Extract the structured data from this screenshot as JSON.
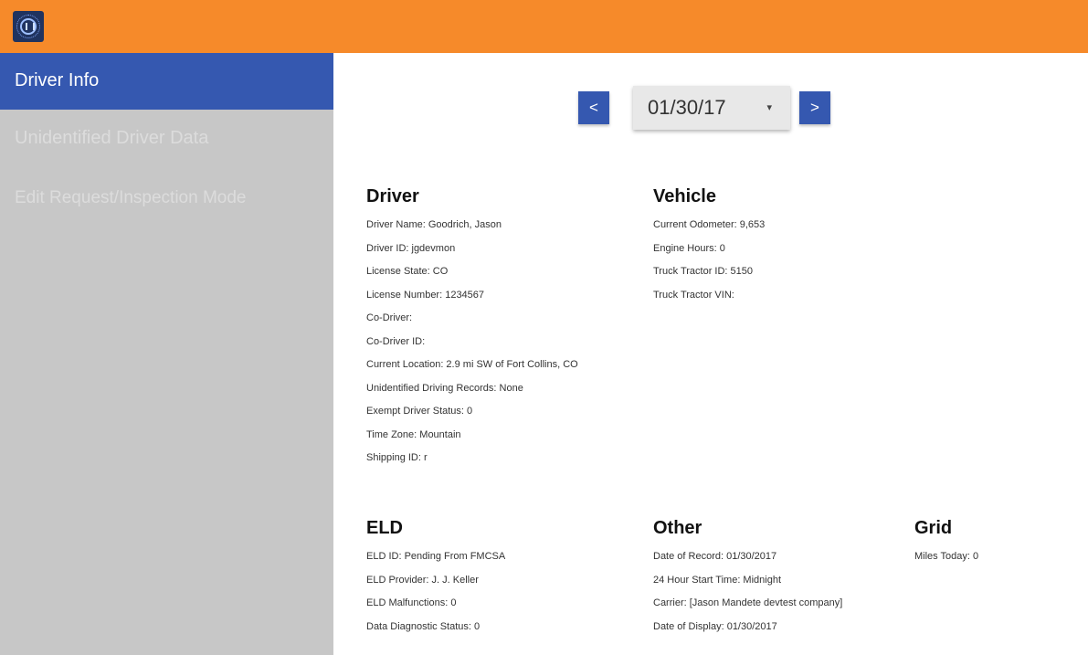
{
  "header": {
    "logo_icon": "truck-logo-icon",
    "app_title": "",
    "background_color": "#f68a2a"
  },
  "sidebar": {
    "items": [
      {
        "label": "Driver Info",
        "active": true
      },
      {
        "label": "Unidentified Driver Data",
        "active": false
      },
      {
        "label": "Edit Request/Inspection Mode",
        "active": false
      }
    ],
    "active_color": "#3558b0"
  },
  "date_nav": {
    "prev_label": "<",
    "next_label": ">",
    "selected_date": "01/30/17",
    "caret": "▾"
  },
  "driver": {
    "heading": "Driver",
    "fields": [
      "Driver Name: Goodrich, Jason",
      "Driver ID: jgdevmon",
      "License State: CO",
      "License Number: 1234567",
      "Co-Driver:",
      "Co-Driver ID:",
      "Current Location: 2.9 mi SW of Fort Collins, CO",
      "Unidentified Driving Records: None",
      "Exempt Driver Status: 0",
      "Time Zone: Mountain",
      "Shipping ID: r"
    ]
  },
  "vehicle": {
    "heading": "Vehicle",
    "fields": [
      "Current Odometer: 9,653",
      "Engine Hours: 0",
      "Truck Tractor ID: 5150",
      "Truck Tractor VIN:"
    ]
  },
  "eld": {
    "heading": "ELD",
    "fields": [
      "ELD ID: Pending From FMCSA",
      "ELD Provider: J. J. Keller",
      "ELD Malfunctions: 0",
      "Data Diagnostic Status: 0"
    ]
  },
  "other": {
    "heading": "Other",
    "fields": [
      "Date of Record: 01/30/2017",
      "24 Hour Start Time: Midnight",
      "Carrier: [Jason Mandete devtest company]",
      "Date of Display: 01/30/2017"
    ]
  },
  "grid": {
    "heading": "Grid",
    "fields": [
      "Miles Today: 0"
    ]
  }
}
